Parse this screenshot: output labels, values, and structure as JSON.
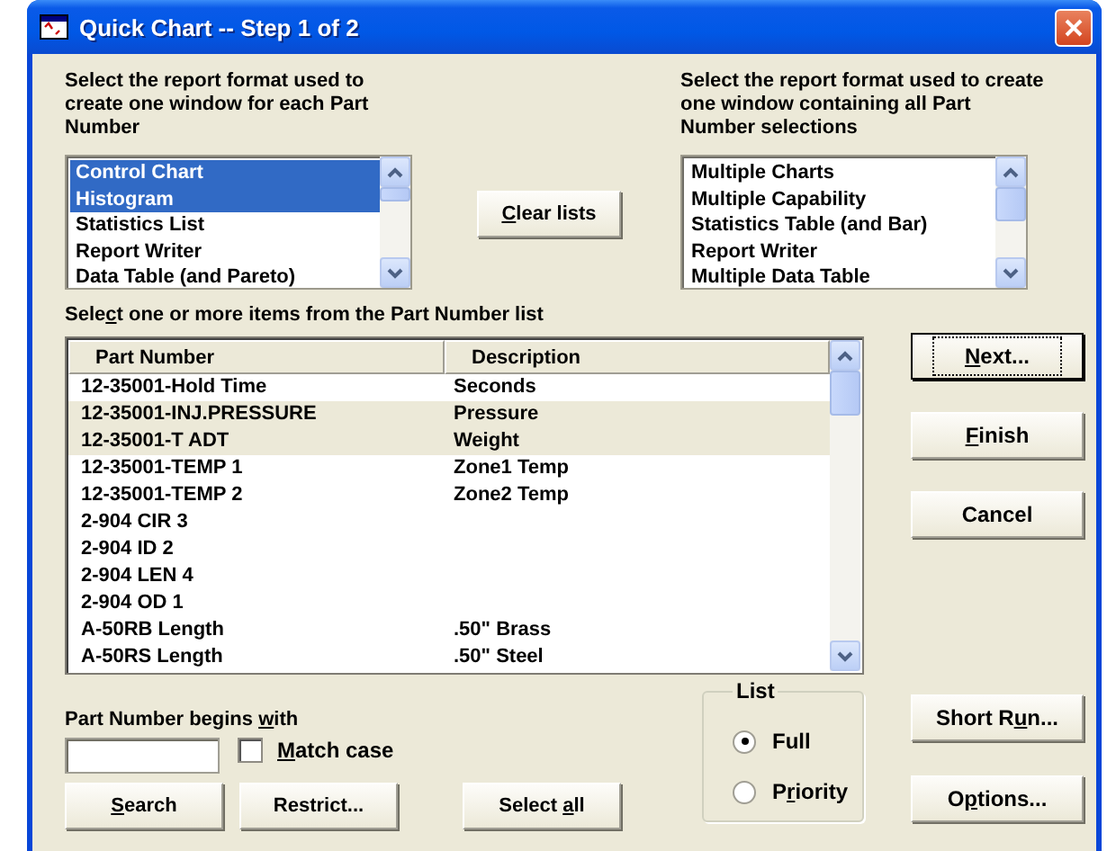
{
  "window": {
    "title": "Quick Chart -- Step 1 of 2"
  },
  "per_part_format": {
    "caption": "Select the report format used to create one window for each Part Number",
    "items": [
      {
        "label": "Control Chart",
        "selected": true
      },
      {
        "label": "Histogram",
        "selected": true
      },
      {
        "label": "Statistics List",
        "selected": false
      },
      {
        "label": "Report Writer",
        "selected": false
      },
      {
        "label": "Data Table (and Pareto)",
        "selected": false
      }
    ]
  },
  "clear_button": {
    "accel": "C",
    "after": "lear lists"
  },
  "all_parts_format": {
    "caption": "Select the report format used to create one window containing all Part Number selections",
    "items": [
      {
        "label": "Multiple Charts",
        "selected": false
      },
      {
        "label": "Multiple Capability",
        "selected": false
      },
      {
        "label": "Statistics Table (and Bar)",
        "selected": false
      },
      {
        "label": "Report Writer",
        "selected": false
      },
      {
        "label": "Multiple Data Table",
        "selected": false
      }
    ]
  },
  "parts_list": {
    "caption": {
      "before": "Sele",
      "accel": "c",
      "after": "t one or more items from the Part Number list"
    },
    "columns": [
      "Part Number",
      "Description"
    ],
    "rows": [
      {
        "part": "12-35001-Hold Time",
        "description": "Seconds",
        "selected": false
      },
      {
        "part": "12-35001-INJ.PRESSURE",
        "description": "Pressure",
        "selected": true
      },
      {
        "part": "12-35001-T ADT",
        "description": "Weight",
        "selected": true
      },
      {
        "part": "12-35001-TEMP 1",
        "description": "Zone1 Temp",
        "selected": false
      },
      {
        "part": "12-35001-TEMP 2",
        "description": "Zone2 Temp",
        "selected": false
      },
      {
        "part": "2-904 CIR 3",
        "selected": false
      },
      {
        "part": "2-904 ID 2",
        "selected": false
      },
      {
        "part": "2-904 LEN 4",
        "selected": false
      },
      {
        "part": "2-904 OD 1",
        "selected": false
      },
      {
        "part": "A-50RB Length",
        "description": ".50\" Brass",
        "selected": false
      },
      {
        "part": "A-50RS Length",
        "description": ".50\" Steel",
        "selected": false
      }
    ]
  },
  "action_buttons": [
    {
      "label": {
        "accel": "N",
        "after": "ext..."
      },
      "default": true
    },
    {
      "label": {
        "accel": "F",
        "after": "inish"
      },
      "default": false
    },
    {
      "label": {
        "before": "Cancel"
      },
      "default": false
    }
  ],
  "filter": {
    "caption": {
      "before": "Part Number begins ",
      "accel": "w",
      "after": "ith"
    },
    "match_case": {
      "label": {
        "accel": "M",
        "after": "atch case"
      },
      "checked": false
    }
  },
  "bottom_buttons": [
    {
      "label": {
        "accel": "S",
        "after": "earch"
      }
    },
    {
      "label": {
        "before": "Restrict..."
      }
    },
    {
      "label": {
        "before": "Select ",
        "accel": "a",
        "after": "ll"
      }
    }
  ],
  "list_group": {
    "title": "List",
    "options": [
      {
        "label": {
          "before": "Full"
        },
        "selected": true
      },
      {
        "label": {
          "before": "P",
          "accel": "r",
          "after": "iority"
        },
        "selected": false
      }
    ]
  },
  "more_buttons": [
    {
      "label": {
        "before": "Short R",
        "accel": "u",
        "after": "n..."
      }
    },
    {
      "label": {
        "before": "O",
        "accel": "p",
        "after": "tions..."
      }
    }
  ]
}
